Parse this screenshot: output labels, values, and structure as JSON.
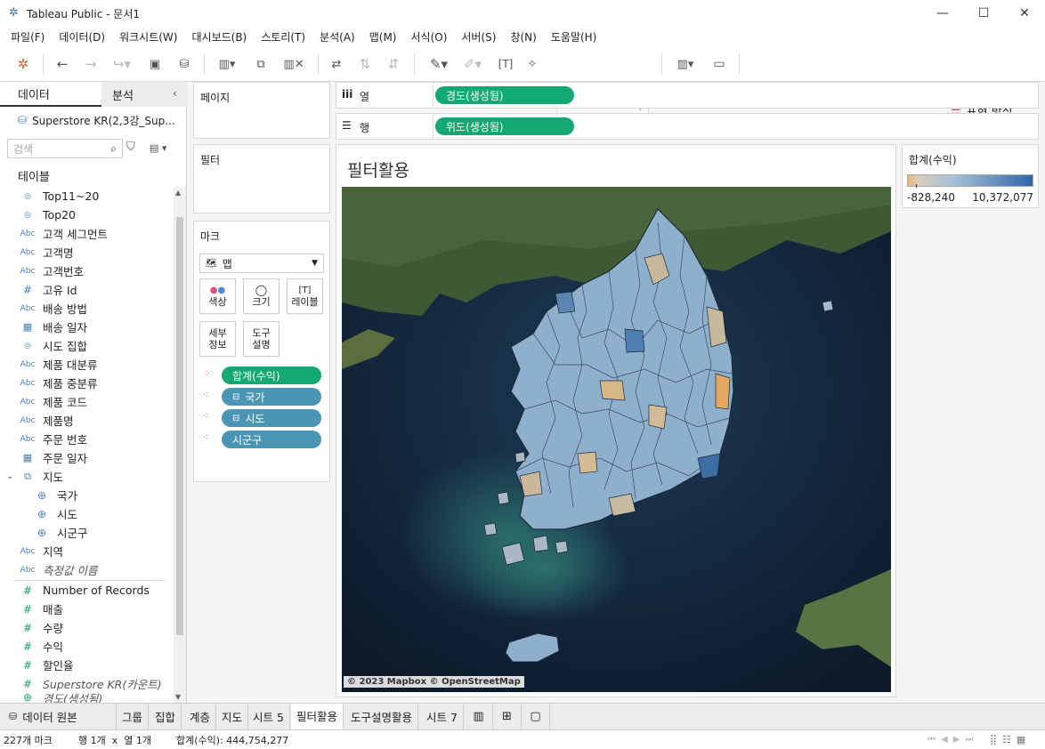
{
  "window": {
    "title": "Tableau Public - 문서1"
  },
  "menu": [
    "파일(F)",
    "데이터(D)",
    "워크시트(W)",
    "대시보드(B)",
    "스토리(T)",
    "분석(A)",
    "맵(M)",
    "서식(O)",
    "서버(S)",
    "창(N)",
    "도움말(H)"
  ],
  "toolbar": {
    "show_me_label": "표현 방식"
  },
  "left_pane": {
    "tab_data": "데이터",
    "tab_analysis": "분석",
    "datasource": "Superstore KR(2,3강_Sup...",
    "search_placeholder": "검색",
    "tables_header": "테이블",
    "fields": [
      {
        "icon": "set",
        "label": "Top11~20"
      },
      {
        "icon": "set",
        "label": "Top20"
      },
      {
        "icon": "Abc",
        "label": "고객 세그먼트"
      },
      {
        "icon": "Abc",
        "label": "고객명"
      },
      {
        "icon": "Abc",
        "label": "고객번호"
      },
      {
        "icon": "#",
        "label": "고유 Id"
      },
      {
        "icon": "Abc",
        "label": "배송 방법"
      },
      {
        "icon": "date",
        "label": "배송 일자"
      },
      {
        "icon": "set",
        "label": "시도 집합"
      },
      {
        "icon": "Abc",
        "label": "제품 대분류"
      },
      {
        "icon": "Abc",
        "label": "제품 중분류"
      },
      {
        "icon": "Abc",
        "label": "제품 코드"
      },
      {
        "icon": "Abc",
        "label": "제품명"
      },
      {
        "icon": "Abc",
        "label": "주문 번호"
      },
      {
        "icon": "date",
        "label": "주문 일자"
      },
      {
        "icon": "hier",
        "label": "지도"
      },
      {
        "icon": "geo",
        "label": "국가"
      },
      {
        "icon": "geo",
        "label": "시도"
      },
      {
        "icon": "geo",
        "label": "시군구"
      },
      {
        "icon": "Abc",
        "label": "지역"
      },
      {
        "icon": "Abc",
        "label": "측정값 이름"
      }
    ],
    "measures": [
      {
        "icon": "#",
        "label": "Number of Records"
      },
      {
        "icon": "#",
        "label": "매출"
      },
      {
        "icon": "#",
        "label": "수량"
      },
      {
        "icon": "#",
        "label": "수익"
      },
      {
        "icon": "#",
        "label": "할인율"
      },
      {
        "icon": "#",
        "label": "Superstore KR(카운트)"
      },
      {
        "icon": "geo",
        "label": "경도(생성됨)"
      }
    ]
  },
  "cards": {
    "pages_label": "페이지",
    "filters_label": "필터",
    "marks_label": "마크",
    "mark_type": "맵",
    "mark_buttons": [
      "색상",
      "크기",
      "레이블",
      "세부\n정보",
      "도구\n설명"
    ],
    "mark_pills": [
      "합계(수익)",
      "국가",
      "시도",
      "시군구"
    ]
  },
  "shelves": {
    "columns_label": "열",
    "rows_label": "행",
    "columns_pill": "경도(생성됨)",
    "rows_pill": "위도(생성됨)"
  },
  "view": {
    "title": "필터활용",
    "attribution": "© 2023 Mapbox © OpenStreetMap"
  },
  "legend": {
    "title": "합계(수익)",
    "min": "-828,240",
    "max": "10,372,077",
    "color_low": "#e8b87a",
    "color_high": "#2f66a8"
  },
  "tabs": [
    "데이터 원본",
    "그룹",
    "집합",
    "계층",
    "지도",
    "시트 5",
    "필터활용",
    "도구설명활용",
    "시트 7"
  ],
  "active_tab": "필터활용",
  "status": {
    "marks": "227개 마크",
    "rows_cols": "행 1개  x  열 1개",
    "sum": "합계(수익): 444,754,277"
  }
}
